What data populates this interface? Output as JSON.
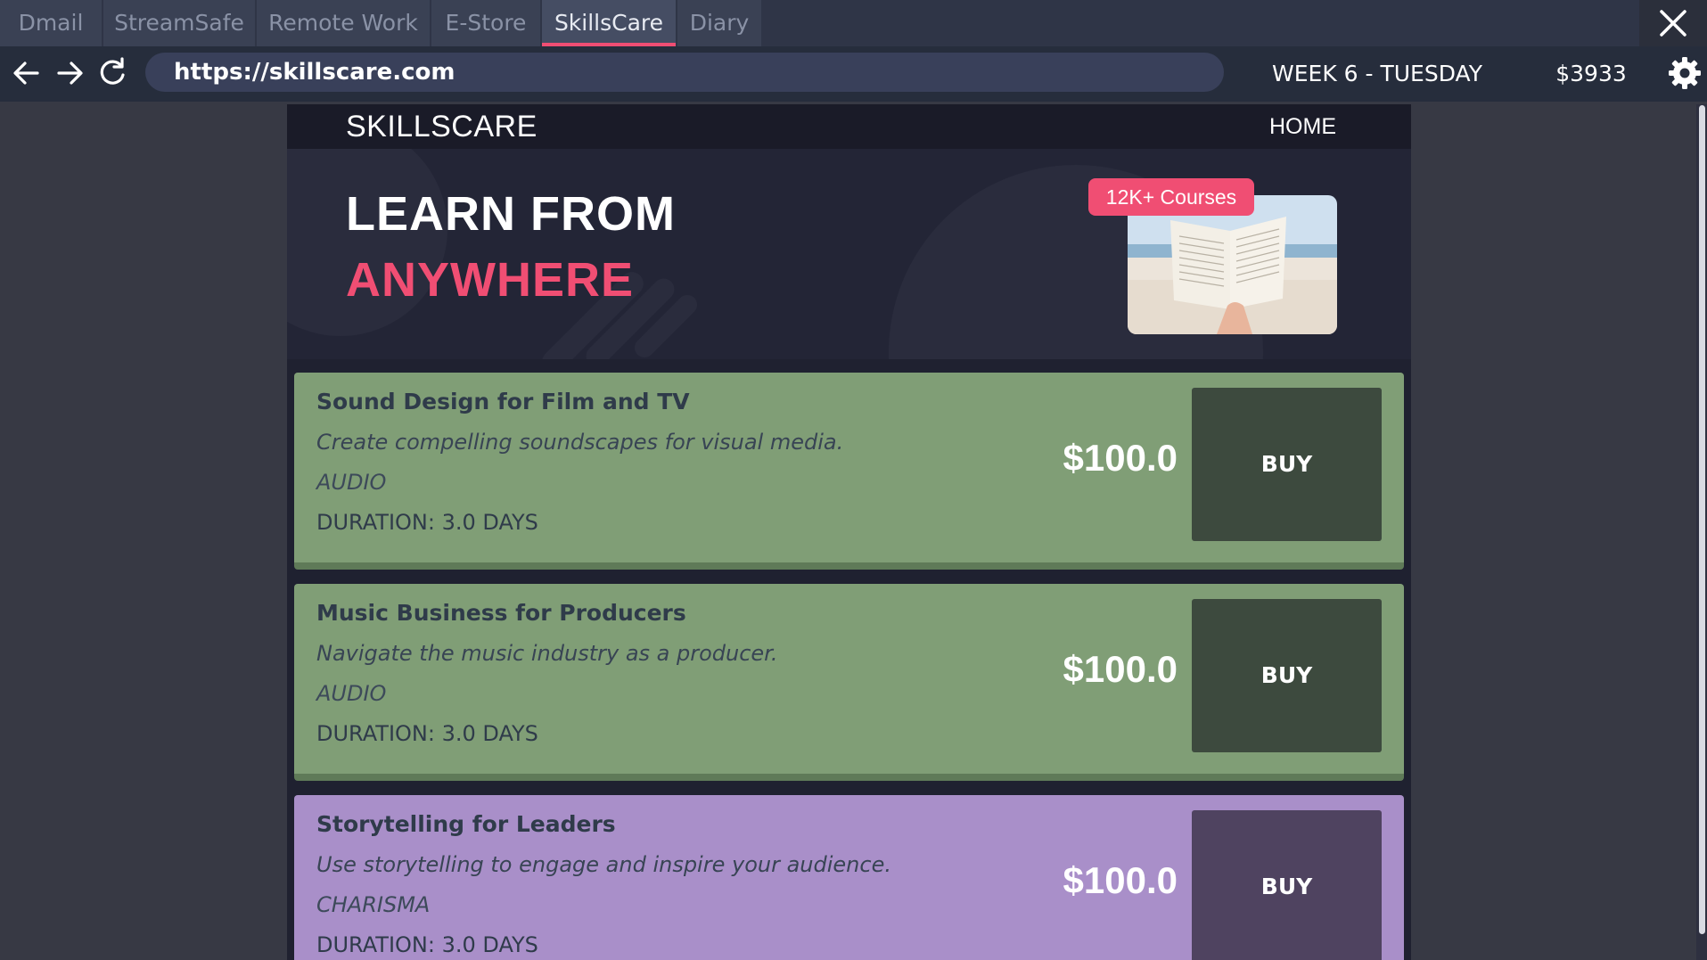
{
  "browser": {
    "tabs": [
      {
        "label": "Dmail",
        "active": false
      },
      {
        "label": "StreamSafe",
        "active": false
      },
      {
        "label": "Remote Work",
        "active": false
      },
      {
        "label": "E-Store",
        "active": false
      },
      {
        "label": "SkillsCare",
        "active": true
      },
      {
        "label": "Diary",
        "active": false
      }
    ],
    "close_icon": "close-icon",
    "url": "https://skillscare.com",
    "week_label": "WEEK 6 - TUESDAY",
    "money": "$3933",
    "icons": [
      "back-arrow-icon",
      "forward-arrow-icon",
      "reload-icon",
      "gear-icon"
    ]
  },
  "site": {
    "logo": "SKILLSCARE",
    "nav_home": "HOME",
    "hero": {
      "line1": "LEARN FROM",
      "line2": "ANYWHERE",
      "badge": "12K+ Courses"
    }
  },
  "courses": [
    {
      "title": "Sound Design for Film and TV",
      "description": "Create compelling soundscapes for visual media.",
      "category": "AUDIO",
      "duration": "DURATION: 3.0 DAYS",
      "price": "$100.0",
      "buy_label": "BUY"
    },
    {
      "title": "Music Business for Producers",
      "description": "Navigate the music industry as a producer.",
      "category": "AUDIO",
      "duration": "DURATION: 3.0 DAYS",
      "price": "$100.0",
      "buy_label": "BUY"
    },
    {
      "title": "Storytelling for Leaders",
      "description": "Use storytelling to engage and inspire your audience.",
      "category": "CHARISMA",
      "duration": "DURATION: 3.0 DAYS",
      "price": "$100.0",
      "buy_label": "BUY"
    }
  ],
  "colors": {
    "accent": "#f04e73",
    "audio_card": "#809e76",
    "charisma_card": "#a98fc9"
  }
}
